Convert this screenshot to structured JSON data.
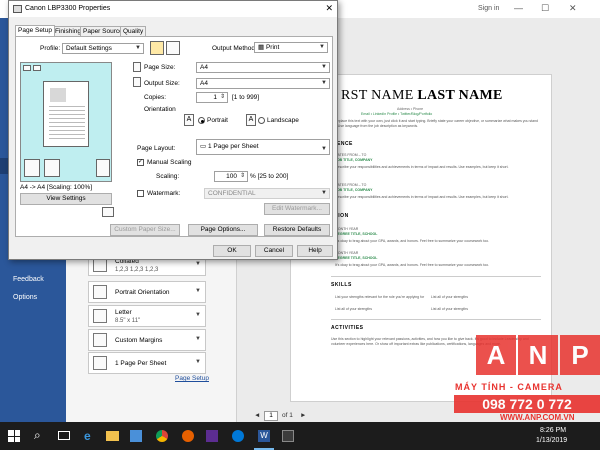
{
  "word": {
    "sign_in": "Sign in",
    "window_controls": {
      "minimize": "—",
      "maximize": "☐",
      "close": "✕"
    },
    "nav": {
      "feedback": "Feedback",
      "options": "Options"
    },
    "settings": [
      {
        "line1": "Collated",
        "line2": "1,2,3    1,2,3    1,2,3"
      },
      {
        "line1": "Portrait Orientation",
        "line2": ""
      },
      {
        "line1": "Letter",
        "line2": "8.5\" x 11\""
      },
      {
        "line1": "Custom Margins",
        "line2": ""
      },
      {
        "line1": "1 Page Per Sheet",
        "line2": ""
      }
    ],
    "page_setup_link": "Page Setup",
    "page_nav": {
      "prev": "◄",
      "current": "1",
      "of_label": "of 1",
      "next": "►"
    }
  },
  "resume": {
    "name_first": "RST NAME",
    "name_last": "LAST NAME",
    "address": "Address • Phone",
    "links": "Email • LinkedIn Profile • Twitter/Blog/Portfolio",
    "intro": "To replace this text with your own, just click it and start typing. Briefly state your career objective, or summarize what makes you stand out. Use language from the job description as keywords.",
    "section_experience": "RIENCE",
    "exp_dates": "DATES FROM – TO",
    "exp_title": "JOB TITLE, COMPANY",
    "exp_desc": "Describe your responsibilities and achievements in terms of impact and results. Use examples, but keep it short.",
    "section_education": "ATION",
    "edu_month": "MONTH YEAR",
    "edu_degree": "DEGREE TITLE, SCHOOL",
    "edu_desc": "It's okay to brag about your GPA, awards, and honors. Feel free to summarize your coursework too.",
    "section_skills": "SKILLS",
    "skill_1": "List your strengths relevant for the role you're applying for",
    "skill_2": "List all of your strengths",
    "section_activities": "ACTIVITIES",
    "act_desc": "Use this section to highlight your relevant passions, activities, and how you like to give back. It's good to include Leadership and volunteer experiences here. Or show off important extras like publications, certifications, languages and more."
  },
  "dialog": {
    "title": "Canon LBP3300 Properties",
    "close": "✕",
    "tabs": [
      "Page Setup",
      "Finishing",
      "Paper Source",
      "Quality"
    ],
    "profile_label": "Profile:",
    "profile_value": "Default Settings",
    "output_method_label": "Output Method:",
    "output_method_value": "Print",
    "page_size_label": "Page Size:",
    "page_size_value": "A4",
    "output_size_label": "Output Size:",
    "output_size_value": "A4",
    "copies_label": "Copies:",
    "copies_value": "1",
    "copies_range": "[1 to 999]",
    "orientation_label": "Orientation",
    "portrait_label": "Portrait",
    "landscape_label": "Landscape",
    "preview_caption": "A4 -> A4 [Scaling: 100%]",
    "view_settings": "View Settings",
    "page_layout_label": "Page Layout:",
    "page_layout_value": "1 Page per Sheet",
    "manual_scaling_label": "Manual Scaling",
    "scaling_label": "Scaling:",
    "scaling_value": "100",
    "scaling_range": "% [25 to 200]",
    "watermark_label": "Watermark:",
    "watermark_value": "CONFIDENTIAL",
    "edit_watermark": "Edit Watermark...",
    "custom_paper_size": "Custom Paper Size...",
    "page_options": "Page Options...",
    "restore_defaults": "Restore Defaults",
    "ok": "OK",
    "cancel": "Cancel",
    "help": "Help"
  },
  "watermark_overlay": {
    "letters": [
      "A",
      "N",
      "P"
    ],
    "line1": "MÁY TÍNH - CAMERA",
    "phone": "098 772 0 772",
    "site": "WWW.ANP.COM.VN"
  },
  "taskbar": {
    "time": "8:26 PM",
    "date": "1/13/2019"
  },
  "colors": {
    "word_blue": "#2b579a",
    "taskbar": "#1c1c1c",
    "accent_red": "#e8332f",
    "resume_green": "#2a8a4a"
  }
}
